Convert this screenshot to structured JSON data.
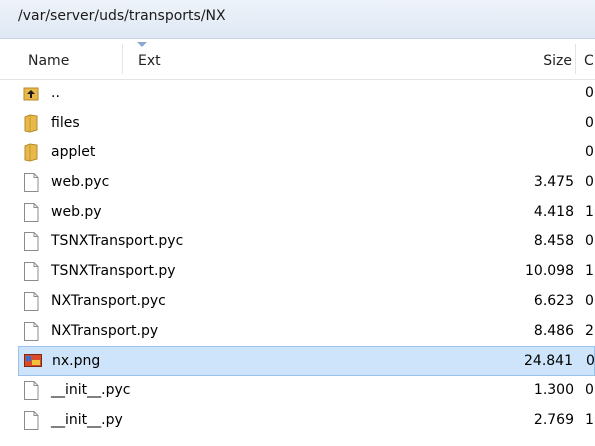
{
  "path": "/var/server/uds/transports/NX",
  "columns": {
    "name": "Name",
    "ext": "Ext",
    "size": "Size",
    "other": "C"
  },
  "rows": [
    {
      "name": "..",
      "size": "",
      "other": "0",
      "icon": "parent-folder-icon",
      "selected": false
    },
    {
      "name": "files",
      "size": "",
      "other": "0",
      "icon": "folder-icon",
      "selected": false
    },
    {
      "name": "applet",
      "size": "",
      "other": "0",
      "icon": "folder-icon",
      "selected": false
    },
    {
      "name": "web.pyc",
      "size": "3.475",
      "other": "0",
      "icon": "file-icon",
      "selected": false
    },
    {
      "name": "web.py",
      "size": "4.418",
      "other": "1",
      "icon": "file-icon",
      "selected": false
    },
    {
      "name": "TSNXTransport.pyc",
      "size": "8.458",
      "other": "0",
      "icon": "file-icon",
      "selected": false
    },
    {
      "name": "TSNXTransport.py",
      "size": "10.098",
      "other": "1",
      "icon": "file-icon",
      "selected": false
    },
    {
      "name": "NXTransport.pyc",
      "size": "6.623",
      "other": "0",
      "icon": "file-icon",
      "selected": false
    },
    {
      "name": "NXTransport.py",
      "size": "8.486",
      "other": "2",
      "icon": "file-icon",
      "selected": false
    },
    {
      "name": "nx.png",
      "size": "24.841",
      "other": "0",
      "icon": "image-file-icon",
      "selected": true
    },
    {
      "name": "__init__.pyc",
      "size": "1.300",
      "other": "0",
      "icon": "file-icon",
      "selected": false
    },
    {
      "name": "__init__.py",
      "size": "2.769",
      "other": "1",
      "icon": "file-icon",
      "selected": false
    }
  ],
  "colors": {
    "selection_bg": "#cde4fb",
    "selection_border": "#99c3ec",
    "folder": "#e8b84a"
  }
}
